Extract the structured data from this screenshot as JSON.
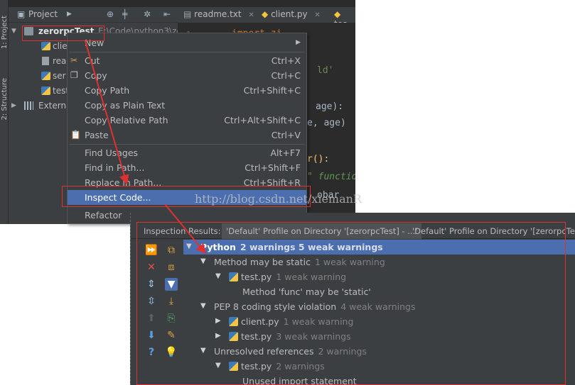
{
  "ide": {
    "side_tabs": [
      "1: Project",
      "2: Structure"
    ],
    "project_panel": {
      "title": "Project",
      "tree": [
        {
          "label": "zerorpcTest",
          "path": "E:\\Code\\python3\\ze"
        },
        {
          "label": "clie"
        },
        {
          "label": "rea"
        },
        {
          "label": "ser"
        },
        {
          "label": "test"
        },
        {
          "label": "Externa"
        }
      ]
    },
    "editor_tabs": [
      "readme.txt",
      "client.py",
      "tes"
    ],
    "editor_lines": [
      "1",
      "import zi",
      "ld'",
      "age):",
      "e, age)",
      "r():",
      "\" functio",
      "obar"
    ]
  },
  "context_menu": {
    "items": [
      {
        "label": "New",
        "shortcut": "",
        "submenu": true
      },
      {
        "label": "Cut",
        "shortcut": "Ctrl+X",
        "icon": "scissors"
      },
      {
        "label": "Copy",
        "shortcut": "Ctrl+C",
        "icon": "copy"
      },
      {
        "label": "Copy Path",
        "shortcut": "Ctrl+Shift+C"
      },
      {
        "label": "Copy as Plain Text",
        "shortcut": ""
      },
      {
        "label": "Copy Relative Path",
        "shortcut": "Ctrl+Alt+Shift+C"
      },
      {
        "label": "Paste",
        "shortcut": "Ctrl+V",
        "icon": "clipboard"
      },
      {
        "label": "Find Usages",
        "shortcut": "Alt+F7"
      },
      {
        "label": "Find in Path...",
        "shortcut": "Ctrl+Shift+F"
      },
      {
        "label": "Replace in Path...",
        "shortcut": "Ctrl+Shift+R"
      },
      {
        "label": "Inspect Code...",
        "shortcut": "",
        "selected": true
      },
      {
        "label": "Refactor",
        "shortcut": ""
      }
    ]
  },
  "inspection": {
    "tab_title": "Inspection Results:",
    "tabs": [
      "'Default' Profile on Directory '[zerorpcTest] - ...'",
      "'Default' Profile on Directory '[zerorpcTest] -"
    ],
    "tree": [
      {
        "label": "Python",
        "count": "2 warnings 5 weak warnings",
        "level": 0
      },
      {
        "label": "Method may be static",
        "count": "1 weak warning",
        "level": 1
      },
      {
        "label": "test.py",
        "count": "1 weak warning",
        "level": 2
      },
      {
        "label": "Method 'func' may be 'static'",
        "count": "",
        "level": 3
      },
      {
        "label": "PEP 8 coding style violation",
        "count": "4 weak warnings",
        "level": 1
      },
      {
        "label": "client.py",
        "count": "1 weak warning",
        "level": 2
      },
      {
        "label": "test.py",
        "count": "3 weak warnings",
        "level": 2
      },
      {
        "label": "Unresolved references",
        "count": "2 warnings",
        "level": 1
      },
      {
        "label": "test.py",
        "count": "2 warnings",
        "level": 2
      },
      {
        "label": "Unused import statement",
        "count": "",
        "level": 3
      }
    ]
  },
  "watermark": "http://blog.csdn.net/xiemanR",
  "colors": {
    "accent_selection": "#4b6eaf",
    "annotation_red": "#e03030",
    "panel_bg": "#3c3f41",
    "editor_bg": "#2b2b2b"
  }
}
